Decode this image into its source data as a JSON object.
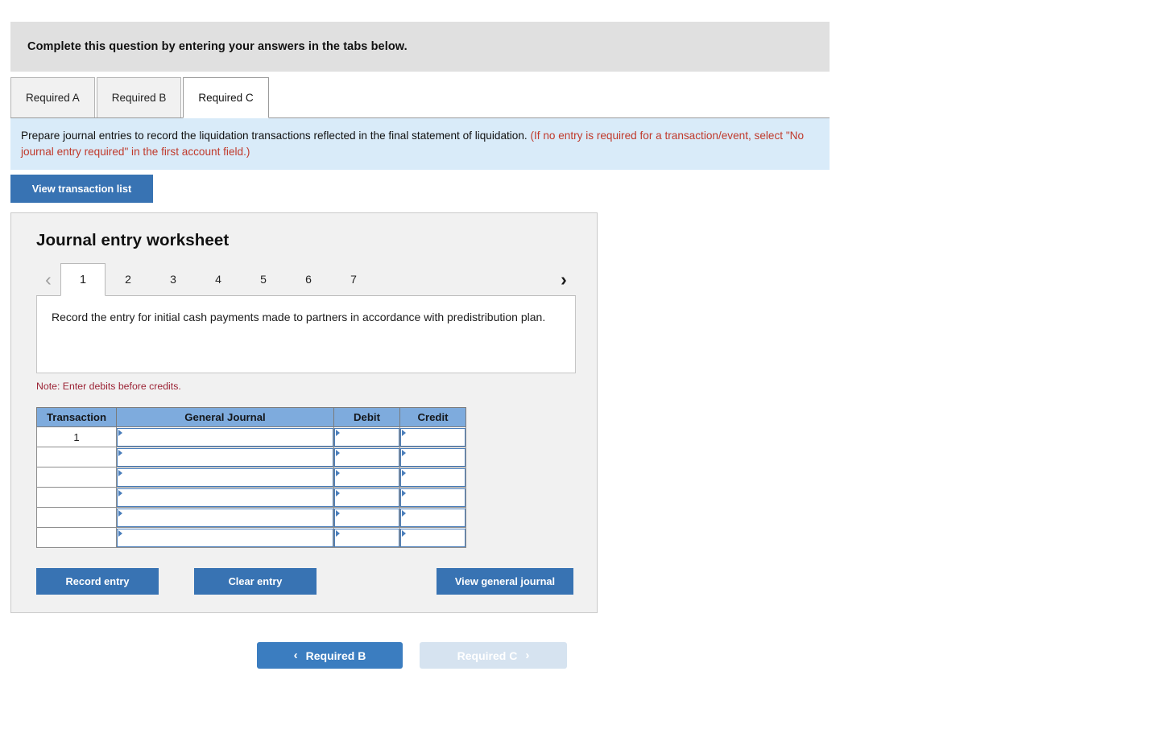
{
  "banner": {
    "text": "Complete this question by entering your answers in the tabs below."
  },
  "tabs": [
    {
      "label": "Required A",
      "active": false
    },
    {
      "label": "Required B",
      "active": false
    },
    {
      "label": "Required C",
      "active": true
    }
  ],
  "instruction": {
    "black_text": "Prepare journal entries to record the liquidation transactions reflected in the final statement of liquidation. ",
    "red_text": "(If no entry is required for a transaction/event, select \"No journal entry required\" in the first account field.)"
  },
  "view_transaction_list_label": "View transaction list",
  "worksheet": {
    "title": "Journal entry worksheet",
    "pager": {
      "prev_icon": "chevron-left-icon",
      "next_icon": "chevron-right-icon",
      "pages": [
        "1",
        "2",
        "3",
        "4",
        "5",
        "6",
        "7"
      ],
      "active_page": "1"
    },
    "description": "Record the entry for initial cash payments made to partners in accordance with predistribution plan.",
    "note": "Note: Enter debits before credits.",
    "table": {
      "headers": [
        "Transaction",
        "General Journal",
        "Debit",
        "Credit"
      ],
      "rows": [
        {
          "transaction": "1",
          "general_journal": "",
          "debit": "",
          "credit": ""
        },
        {
          "transaction": "",
          "general_journal": "",
          "debit": "",
          "credit": ""
        },
        {
          "transaction": "",
          "general_journal": "",
          "debit": "",
          "credit": ""
        },
        {
          "transaction": "",
          "general_journal": "",
          "debit": "",
          "credit": ""
        },
        {
          "transaction": "",
          "general_journal": "",
          "debit": "",
          "credit": ""
        },
        {
          "transaction": "",
          "general_journal": "",
          "debit": "",
          "credit": ""
        }
      ]
    },
    "buttons": {
      "record_entry": "Record entry",
      "clear_entry": "Clear entry",
      "view_general_journal": "View general journal"
    }
  },
  "bottom_nav": {
    "prev_label": "Required B",
    "prev_icon": "chevron-left-icon",
    "next_label": "Required C",
    "next_icon": "chevron-right-icon"
  },
  "colors": {
    "accent_blue": "#3873b3",
    "table_header_blue": "#7eabdd",
    "instruction_bg": "#d9ebf9",
    "banner_bg": "#e0e0e0",
    "panel_bg": "#f1f1f1",
    "note_red": "#9b2335",
    "instruction_red": "#c0392b",
    "disabled_blue": "#d6e3f0"
  }
}
